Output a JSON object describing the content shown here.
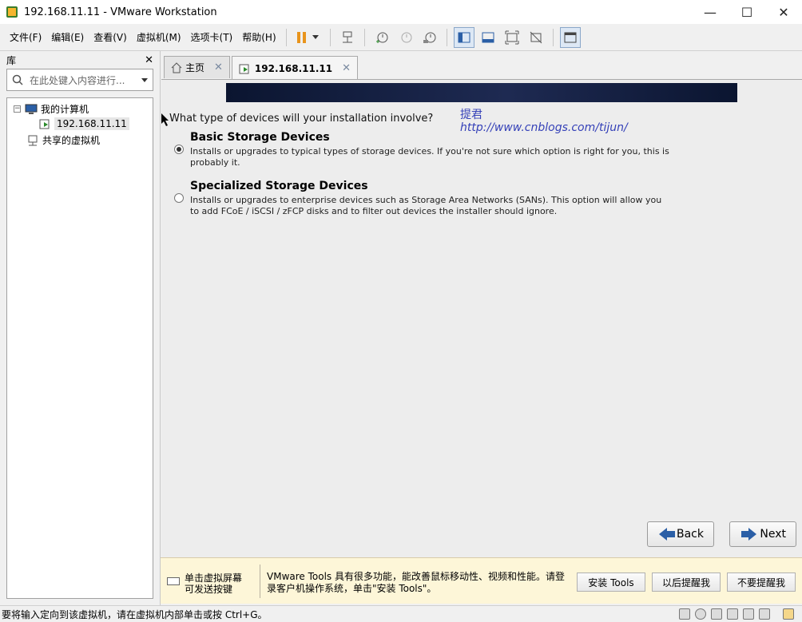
{
  "window": {
    "title": "192.168.11.11 - VMware Workstation"
  },
  "menu": [
    "文件(F)",
    "编辑(E)",
    "查看(V)",
    "虚拟机(M)",
    "选项卡(T)",
    "帮助(H)"
  ],
  "library": {
    "title": "库",
    "search_placeholder": "在此处键入内容进行...",
    "tree": {
      "my_computer": "我的计算机",
      "vm_name": "192.168.11.11",
      "shared_vms": "共享的虚拟机"
    }
  },
  "tabs": {
    "home": "主页",
    "vm": "192.168.11.11"
  },
  "installer": {
    "question": "What type of devices will your installation involve?",
    "watermark_name": "提君",
    "watermark_url": "http://www.cnblogs.com/tijun/",
    "options": [
      {
        "title": "Basic Storage Devices",
        "description": "Installs or upgrades to typical types of storage devices.  If you're not sure which option is right for you, this is probably it.",
        "selected": true
      },
      {
        "title": "Specialized Storage Devices",
        "description": "Installs or upgrades to enterprise devices such as Storage Area Networks (SANs). This option will allow you to add FCoE / iSCSI / zFCP disks and to filter out devices the installer should ignore.",
        "selected": false
      }
    ],
    "back_label": "Back",
    "next_label": "Next"
  },
  "notification": {
    "hint": "单击虚拟屏幕\n可发送按键",
    "message": "VMware Tools 具有很多功能，能改善鼠标移动性、视频和性能。请登录客户机操作系统，单击\"安装 Tools\"。",
    "install_label": "安装 Tools",
    "later_label": "以后提醒我",
    "never_label": "不要提醒我"
  },
  "status": {
    "text": "要将输入定向到该虚拟机，请在虚拟机内部单击或按 Ctrl+G。"
  }
}
